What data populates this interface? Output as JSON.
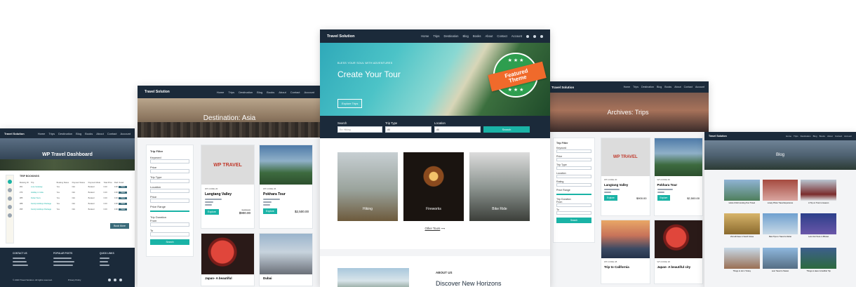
{
  "brand": "Travel Solution",
  "nav_items": [
    "Home",
    "Trips",
    "Destination",
    "Blog",
    "Books",
    "About",
    "Contact",
    "Account"
  ],
  "center": {
    "tagline": "BLESS YOUR SOUL WITH ADVENTURES",
    "hero_title": "Create Your Tour",
    "hero_button": "Explore Trips",
    "badge_line1": "Featured",
    "badge_line2": "Theme",
    "search_label": "Search",
    "trip_type_label": "Trip Type",
    "location_label": "Location",
    "search_placeholder": "Ex: Hiking",
    "select_all": "All",
    "search_button": "Search",
    "types": [
      "Hiking",
      "Fireworks",
      "Bike Ride"
    ],
    "other_tours": "Other Tours",
    "about_label": "ABOUT US",
    "about_title": "Discover New Horizons"
  },
  "left": {
    "hero_title": "WP Travel Dashboard",
    "section_label": "TRIP BOOKINGS",
    "table_headers": [
      "Booking ID",
      "Trip",
      "Booking Status",
      "Payment Status",
      "Payment Mode",
      "Total Price",
      "Paid",
      "Detail"
    ],
    "rows": [
      [
        "#61",
        "Luxe Getaway",
        "Yes",
        "N/A",
        "Booked",
        "0.00",
        "0.00",
        "View"
      ],
      [
        "#76",
        "Holiday in India",
        "Yes",
        "N/A",
        "Booked",
        "0.00",
        "0.00",
        "View"
      ],
      [
        "#85",
        "Dubai Tours",
        "Yes",
        "N/A",
        "Booked",
        "0.00",
        "0.00",
        "View"
      ],
      [
        "#88",
        "Family Holidays Package",
        "Yes",
        "N/A",
        "Booked",
        "0.00",
        "0.00",
        "View"
      ],
      [
        "#95",
        "Family Holidays Package",
        "Yes",
        "N/A",
        "Booked",
        "0.00",
        "0.00",
        "View"
      ]
    ],
    "book_more": "Book More",
    "footer_cols": [
      "CONTACT US",
      "POPULAR POSTS",
      "QUICK LINKS"
    ],
    "copyright": "© 2023 Travel Solution. All rights reserved.",
    "privacy": "Privacy Policy"
  },
  "mid_left": {
    "hero_title": "Destination: Asia",
    "filter_title": "Trip Filter",
    "filter_labels": [
      "Keyword",
      "Price",
      "Trip Type",
      "Location",
      "Price",
      "Price Range",
      "Trip Duration",
      "From",
      "To"
    ],
    "filter_button": "Search",
    "trips": [
      {
        "code": "WT-CODE 20",
        "title": "Langtang Valley",
        "price": "$900.00",
        "old": "$1000.00",
        "button": "Explore"
      },
      {
        "code": "WT-CODE 26",
        "title": "Pokhara Tour",
        "price": "$2,500.00",
        "old": "",
        "button": "Explore"
      }
    ],
    "logo_text": "WP TRAVEL",
    "more_titles": [
      "Japan- A beautiful",
      "Dubai"
    ]
  },
  "mid_right": {
    "hero_title": "Archives: Trips",
    "filter_title": "Trip Filter",
    "filter_labels": [
      "Keyword",
      "Price",
      "Trip Type",
      "Location",
      "Rating",
      "Price Range",
      "Trip Duration",
      "From",
      "To"
    ],
    "filter_button": "Search",
    "logo_text": "WP TRAVEL",
    "trips": [
      {
        "code": "WT-CODE 20",
        "title": "Langtang Valley",
        "price": "$900.00",
        "button": "Explore"
      },
      {
        "code": "WT-CODE 26",
        "title": "Pokhara Tour",
        "price": "$2,500.00",
        "button": "Explore"
      },
      {
        "code": "WT-CODE 28",
        "title": "Trip to California",
        "price": "",
        "button": ""
      },
      {
        "code": "WT-CODE 18",
        "title": "Japan- A beautiful city",
        "price": "",
        "button": ""
      }
    ]
  },
  "right": {
    "hero_title": "Blog",
    "posts": [
      "Hook & Fish Hunting Tour Travel",
      "Lovely Photo Travel Experience",
      "A Trip on Train to Heaven",
      "Visit all these in South Korea",
      "Best Tips to Travel to Dubai",
      "Lets Visit Tours in Bhutan",
      "Things to do in Turkey",
      "Lets Travel to Taiwan",
      "Things to Have Incredible Trip"
    ]
  },
  "colors": {
    "navy": "#1b2a3a",
    "teal": "#1ab3a6",
    "orange": "#f06a2b",
    "green": "#2e9e4f"
  }
}
